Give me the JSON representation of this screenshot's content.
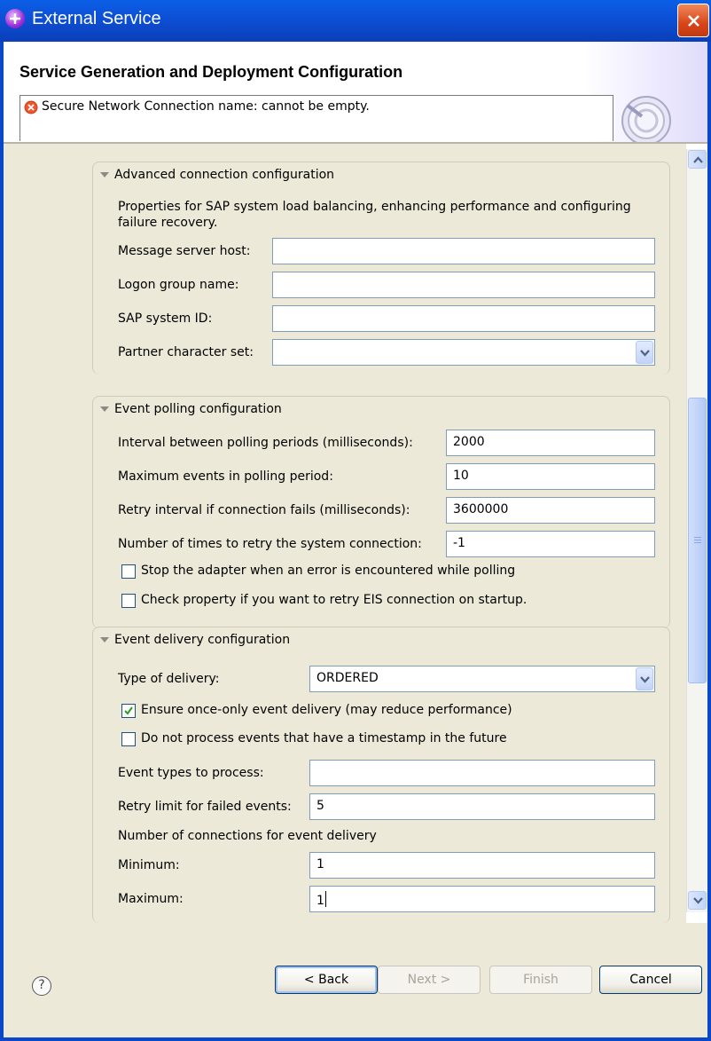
{
  "window": {
    "title": "External Service"
  },
  "header": {
    "title": "Service Generation and Deployment Configuration",
    "error_message": "Secure Network Connection name: cannot be empty."
  },
  "advanced": {
    "heading": "Advanced connection configuration",
    "description_line1": "Properties for SAP system load balancing, enhancing performance and configuring",
    "description_line2": "failure recovery.",
    "message_server_host": {
      "label": "Message server host:",
      "value": ""
    },
    "logon_group_name": {
      "label": "Logon group name:",
      "value": ""
    },
    "sap_system_id": {
      "label": "SAP system ID:",
      "value": ""
    },
    "partner_charset": {
      "label": "Partner character set:",
      "value": ""
    }
  },
  "polling": {
    "heading": "Event polling configuration",
    "interval": {
      "label": "Interval between polling periods (milliseconds):",
      "value": "2000"
    },
    "max_events": {
      "label": "Maximum events in polling period:",
      "value": "10"
    },
    "retry_interval": {
      "label": "Retry interval if connection fails (milliseconds):",
      "value": "3600000"
    },
    "retry_count": {
      "label": "Number of times to retry the system connection:",
      "value": "-1"
    },
    "stop_on_error": {
      "label": "Stop the adapter when an error is encountered while polling",
      "checked": false
    },
    "retry_on_startup": {
      "label": "Check property if you want to retry EIS connection on startup.",
      "checked": false
    }
  },
  "delivery": {
    "heading": "Event delivery configuration",
    "type": {
      "label": "Type of delivery:",
      "value": "ORDERED"
    },
    "once_only": {
      "label": "Ensure once-only event delivery (may reduce performance)",
      "checked": true
    },
    "skip_future": {
      "label": "Do not process events that have a timestamp in the future",
      "checked": false
    },
    "event_types": {
      "label": "Event types to process:",
      "value": ""
    },
    "retry_limit": {
      "label": "Retry limit for failed events:",
      "value": "5"
    },
    "connections_heading": "Number of connections for event delivery",
    "minimum": {
      "label": "Minimum:",
      "value": "1"
    },
    "maximum": {
      "label": "Maximum:",
      "value": "1"
    }
  },
  "buttons": {
    "help": "?",
    "back": "< Back",
    "next": "Next >",
    "finish": "Finish",
    "cancel": "Cancel"
  },
  "colors": {
    "titlebar": "#0d4fd5",
    "dialog_bg": "#ece9d8",
    "field_border": "#7f9db9",
    "error": "#d9441a"
  },
  "icons": [
    "app-icon",
    "close-icon",
    "error-icon",
    "wizard-graphic",
    "twistie-icon",
    "dropdown-arrow-icon",
    "checkmark-icon",
    "scroll-up-icon",
    "scroll-down-icon",
    "help-icon"
  ]
}
